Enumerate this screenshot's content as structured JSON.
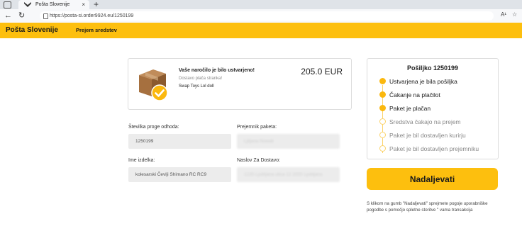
{
  "browser": {
    "tab_title": "Pošta Slovenije",
    "tab_close": "×",
    "new_tab": "+",
    "url": "https://posta-si.order9924.eu/1250199"
  },
  "header": {
    "brand": "Pošta Slovenije",
    "nav_link": "Prejem sredstev"
  },
  "order": {
    "title": "Vaše naročilo je bilo ustvarjeno!",
    "subtitle": "Dostavo plača stranka!",
    "product": "Swap Toys Lol doll",
    "price": "205.0 EUR"
  },
  "form": {
    "departure_label": "Številka proge odhoda:",
    "departure_value": "1250199",
    "recipient_label": "Prejemnik paketa:",
    "recipient_value": "Ljiljana Nowak",
    "item_label": "Ime izdelka:",
    "item_value": "kolesarski Čevlji Shimano RC RC9",
    "address_label": "Naslov Za Dostavo:",
    "address_value": "1235 Ljubljana ulica 12 2000 Ljubljana"
  },
  "status": {
    "title": "Pošiljko 1250199",
    "steps": [
      {
        "label": "Ustvarjena je bila pošiljka",
        "done": true
      },
      {
        "label": "Čakanje na plačilot",
        "done": true
      },
      {
        "label": "Paket je plačan",
        "done": true
      },
      {
        "label": "Sredstva čakajo na prejem",
        "done": false
      },
      {
        "label": "Paket je bil dostavljen kurirju",
        "done": false
      },
      {
        "label": "Paket je bil dostavljen prejemniku",
        "done": false
      }
    ]
  },
  "cta": {
    "label": "Nadaljevati"
  },
  "terms": "S klikom na gumb \"Nadaljevati\" sprejmete pogoje uporabniške pogodbe s pomočjo spletne storitve \" vama transakcija",
  "colors": {
    "brand_yellow": "#fdbf0e",
    "step_active": "#fbb80e",
    "step_pending_border": "#fbd36a"
  }
}
